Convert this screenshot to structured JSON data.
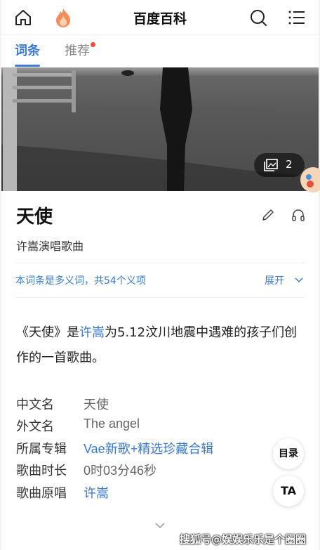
{
  "header": {
    "title": "百度百科",
    "home_icon": "home-icon",
    "brand_icon": "flame-logo-icon",
    "search_icon": "search-icon",
    "menu_icon": "menu-list-icon"
  },
  "tabs": [
    {
      "label": "词条",
      "active": true
    },
    {
      "label": "推荐",
      "active": false,
      "has_dot": true
    }
  ],
  "hero": {
    "photo_count": "2",
    "photo_icon": "gallery-icon"
  },
  "entry": {
    "title": "天使",
    "subtitle": "许嵩演唱歌曲",
    "edit_icon": "pencil-icon",
    "listen_icon": "headphones-icon"
  },
  "polysemy": {
    "text": "本词条是多义词，共54个义项",
    "expand_label": "展开"
  },
  "summary": {
    "part1": "《天使》是",
    "link": "许嵩",
    "part2": "为5.12汶川地震中遇难的孩子们创作的一首歌曲。"
  },
  "infobox": [
    {
      "key": "中文名",
      "value": "天使",
      "is_link": false
    },
    {
      "key": "外文名",
      "value": "The angel",
      "is_link": false
    },
    {
      "key": "所属专辑",
      "value": "Vae新歌+精选珍藏合辑",
      "is_link": true
    },
    {
      "key": "歌曲时长",
      "value": "0时03分46秒",
      "is_link": false
    },
    {
      "key": "歌曲原唱",
      "value": "许嵩",
      "is_link": true
    }
  ],
  "floating": {
    "toc_label": "目录",
    "font_label": "TA"
  },
  "watermark": "搜狐号@娱娱乐乐是个圈圈",
  "colors": {
    "accent": "#3c7bd9",
    "link": "#3a79c7",
    "dot": "#f04d3c"
  }
}
